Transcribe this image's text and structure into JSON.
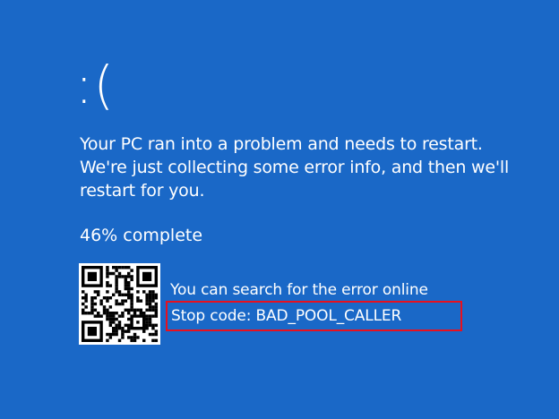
{
  "colors": {
    "background": "#1a68c7",
    "text": "#ffffff",
    "highlight_border": "#e8101e",
    "qr_dark": "#000000",
    "qr_light": "#ffffff"
  },
  "screen": {
    "emoticon": ":(",
    "message_lines": [
      "Your PC ran into a problem and needs to restart.",
      "We're just collecting some error info, and then we'll",
      "restart for you."
    ],
    "progress_percent": 46,
    "progress_text": "46% complete",
    "info_text": "You can search for the error online",
    "stop_code_text": "Stop code: BAD_POOL_CALLER"
  },
  "icons": {
    "qr": "qr-code-icon"
  }
}
